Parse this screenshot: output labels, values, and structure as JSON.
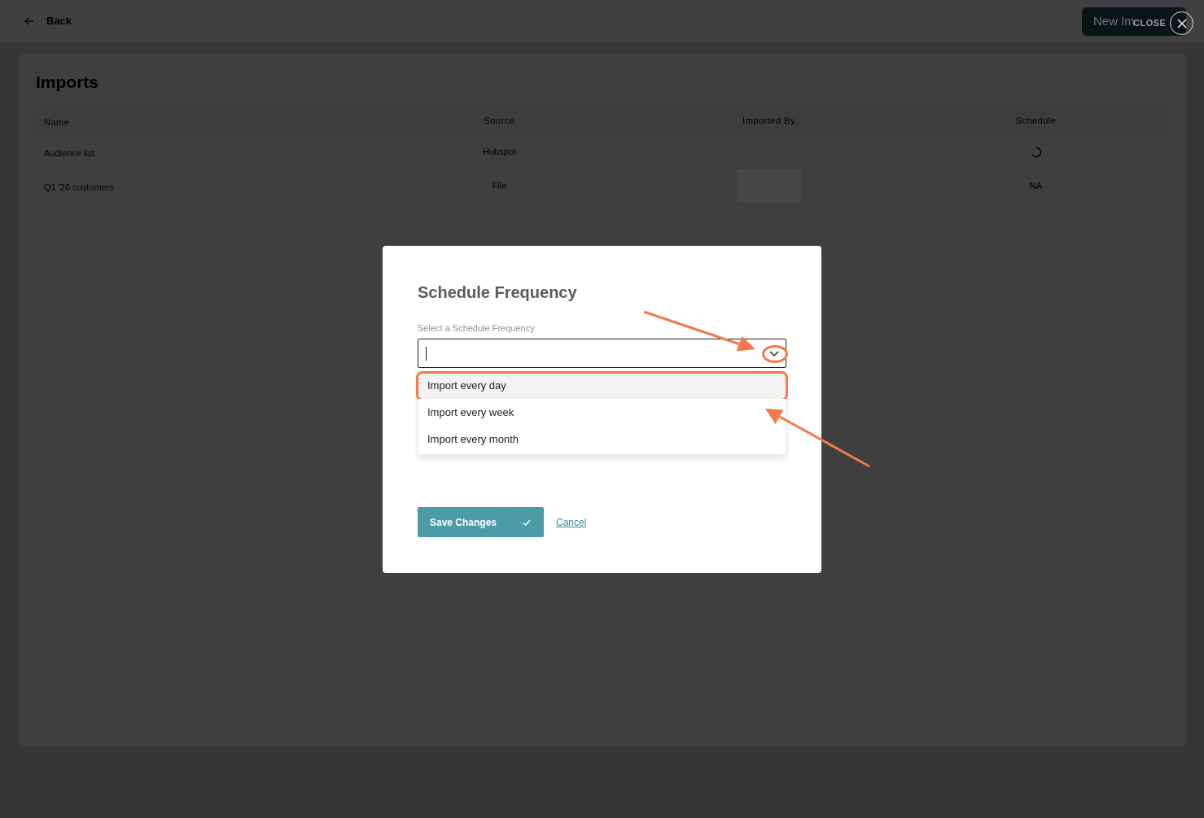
{
  "header": {
    "back_label": "Back",
    "new_import_label": "New Im"
  },
  "close": {
    "label": "CLOSE"
  },
  "page": {
    "title": "Imports"
  },
  "table": {
    "columns": [
      "Name",
      "Source",
      "Imported By",
      "Schedule"
    ],
    "rows": [
      {
        "name": "Audience list",
        "source": "Hubspot",
        "schedule": {
          "kind": "loading"
        }
      },
      {
        "name": "Q1 '26 customers",
        "source": "File",
        "imported_by": {
          "kind": "redacted"
        },
        "schedule": {
          "kind": "text",
          "text": "NA"
        }
      }
    ]
  },
  "modal": {
    "title": "Schedule Frequency",
    "field_label": "Select a Schedule Frequency",
    "dropdown": {
      "focused": true,
      "expanded": true,
      "annotated": true,
      "options": [
        {
          "label": "Import every day",
          "selected": true,
          "annotated": true
        },
        {
          "label": "Import every week",
          "selected": false,
          "annotated": false
        },
        {
          "label": "Import every month",
          "selected": false,
          "annotated": false
        }
      ]
    },
    "save_label": "Save Changes",
    "cancel_label": "Cancel"
  }
}
